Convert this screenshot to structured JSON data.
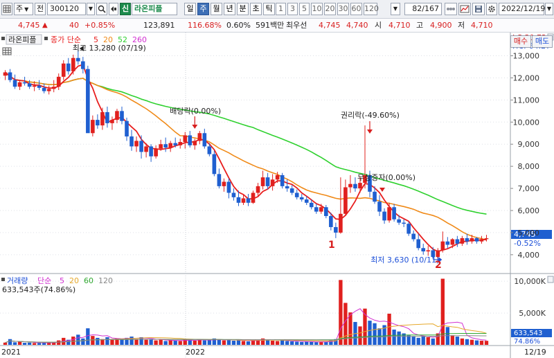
{
  "toolbar": {
    "grid_icon": "grid-icon",
    "type_label": "주",
    "sub_label": "전",
    "code": "300120",
    "search_icon": "search-icon",
    "zoom_icon": "zoom-icon",
    "credit_badge": "신",
    "stock_name": "라온피플",
    "period_tabs": [
      "일",
      "주",
      "월",
      "년",
      "분",
      "초",
      "틱"
    ],
    "active_period": "주",
    "intervals": [
      "1",
      "3",
      "5",
      "10",
      "20",
      "30",
      "60",
      "120"
    ],
    "page_counter": "82/167",
    "date": "2022/12/19"
  },
  "quote": {
    "price": "4,745",
    "change_arrow": "▲",
    "change": "40",
    "change_pct": "+0.85%",
    "volume": "123,891",
    "vol_ratio": "116.68%",
    "turnover": "0.60%",
    "bid_amount": "591백만",
    "bid_label": "최우선",
    "ask_price": "4,745",
    "bid_price": "4,740",
    "open_label": "시",
    "open": "4,710",
    "high_label": "고",
    "high": "4,900",
    "low_label": "저",
    "low": "4,710",
    "buy_label": "매수",
    "sell_label": "매도"
  },
  "price_panel": {
    "stock_label": "라온피플",
    "indicator_label": "종가 단순",
    "ma_periods": [
      "5",
      "20",
      "52",
      "260"
    ],
    "ma_colors": [
      "#e81e1e",
      "#f08a18",
      "#2fd12f",
      "#d12fd1"
    ],
    "lc_label": "LC:30.72",
    "hc_label": "HC:-64.27",
    "current_price": "4,745",
    "current_pct": "-0.52%",
    "high_note": "최고 13,280 (07/19)",
    "low_note": "최저 3,630 (10/11)",
    "event_dividend": "배당락(0.00%)",
    "event_rights": "권리락(-49.60%)",
    "event_bonus": "무상증자(0.00%)",
    "marker_1": "1",
    "marker_2": "2"
  },
  "volume_panel": {
    "label": "거래량",
    "indicator_label": "단순",
    "ma_periods": [
      "5",
      "20",
      "60",
      "120"
    ],
    "value_label": "633,543주(74.86%)",
    "current_volume": "633,543",
    "current_pct": "74.86%"
  },
  "x_axis": [
    "2021",
    "2022",
    "12/19"
  ],
  "colors": {
    "up": "#e0201e",
    "down": "#1f5fd0",
    "accent": "#3d6fb6"
  },
  "chart_data": {
    "type": "candlestick",
    "title": "라온피플 주",
    "y_axis": {
      "ticks": [
        4000,
        5000,
        6000,
        7000,
        8000,
        9000,
        10000,
        11000,
        12000,
        13000
      ],
      "tick_labels": [
        "4,000",
        "5,000",
        "6,000",
        "7,000",
        "8,000",
        "9,000",
        "10,000",
        "11,000",
        "12,000",
        "13,000"
      ],
      "ylim": [
        3400,
        13800
      ]
    },
    "volume_axis": {
      "ticks": [
        5000000,
        10000000
      ],
      "tick_labels": [
        "5,000K",
        "10,000K"
      ],
      "ylim": [
        0,
        11000000
      ]
    },
    "candles": [
      {
        "o": 12100,
        "h": 12350,
        "l": 11900,
        "c": 12250
      },
      {
        "o": 12250,
        "h": 12400,
        "l": 11800,
        "c": 11900
      },
      {
        "o": 11900,
        "h": 12150,
        "l": 11500,
        "c": 11600
      },
      {
        "o": 11600,
        "h": 11900,
        "l": 11450,
        "c": 11800
      },
      {
        "o": 11800,
        "h": 12050,
        "l": 11650,
        "c": 11750
      },
      {
        "o": 11750,
        "h": 11900,
        "l": 11500,
        "c": 11600
      },
      {
        "o": 11600,
        "h": 11850,
        "l": 11400,
        "c": 11650
      },
      {
        "o": 11650,
        "h": 11900,
        "l": 11450,
        "c": 11550
      },
      {
        "o": 11550,
        "h": 11750,
        "l": 11300,
        "c": 11400
      },
      {
        "o": 11400,
        "h": 11650,
        "l": 11250,
        "c": 11500
      },
      {
        "o": 11500,
        "h": 11900,
        "l": 11350,
        "c": 11600
      },
      {
        "o": 11600,
        "h": 12200,
        "l": 11450,
        "c": 12050
      },
      {
        "o": 12050,
        "h": 12800,
        "l": 11900,
        "c": 12650
      },
      {
        "o": 12650,
        "h": 12900,
        "l": 12150,
        "c": 12300
      },
      {
        "o": 12300,
        "h": 13050,
        "l": 12150,
        "c": 12900
      },
      {
        "o": 12900,
        "h": 13280,
        "l": 12600,
        "c": 12750
      },
      {
        "o": 12750,
        "h": 12950,
        "l": 12200,
        "c": 12400
      },
      {
        "o": 12400,
        "h": 12550,
        "l": 9600,
        "c": 9500
      },
      {
        "o": 9500,
        "h": 10300,
        "l": 9350,
        "c": 10100
      },
      {
        "o": 10100,
        "h": 10350,
        "l": 9700,
        "c": 9850
      },
      {
        "o": 9850,
        "h": 10650,
        "l": 9650,
        "c": 10450
      },
      {
        "o": 10450,
        "h": 10700,
        "l": 9750,
        "c": 9950
      },
      {
        "o": 9950,
        "h": 10250,
        "l": 9650,
        "c": 10100
      },
      {
        "o": 10100,
        "h": 10600,
        "l": 9950,
        "c": 10500
      },
      {
        "o": 10500,
        "h": 10700,
        "l": 9900,
        "c": 10050
      },
      {
        "o": 10050,
        "h": 10200,
        "l": 9150,
        "c": 9350
      },
      {
        "o": 9350,
        "h": 9650,
        "l": 8700,
        "c": 8900
      },
      {
        "o": 8900,
        "h": 9350,
        "l": 8650,
        "c": 9150
      },
      {
        "o": 9150,
        "h": 9400,
        "l": 8350,
        "c": 8650
      },
      {
        "o": 8650,
        "h": 9050,
        "l": 8400,
        "c": 8900
      },
      {
        "o": 8900,
        "h": 9000,
        "l": 8200,
        "c": 8450
      },
      {
        "o": 8450,
        "h": 8950,
        "l": 8350,
        "c": 8800
      },
      {
        "o": 8800,
        "h": 9200,
        "l": 8700,
        "c": 9000
      },
      {
        "o": 9000,
        "h": 9300,
        "l": 8650,
        "c": 8850
      },
      {
        "o": 8850,
        "h": 9150,
        "l": 8650,
        "c": 9050
      },
      {
        "o": 9050,
        "h": 9300,
        "l": 8850,
        "c": 8950
      },
      {
        "o": 8950,
        "h": 9250,
        "l": 8800,
        "c": 9100
      },
      {
        "o": 9100,
        "h": 9550,
        "l": 8800,
        "c": 9400
      },
      {
        "o": 9400,
        "h": 9600,
        "l": 8850,
        "c": 8950
      },
      {
        "o": 8950,
        "h": 9250,
        "l": 8750,
        "c": 9150
      },
      {
        "o": 9150,
        "h": 9600,
        "l": 9000,
        "c": 9500
      },
      {
        "o": 9500,
        "h": 9700,
        "l": 8800,
        "c": 8900
      },
      {
        "o": 8900,
        "h": 9050,
        "l": 8450,
        "c": 8550
      },
      {
        "o": 8550,
        "h": 8700,
        "l": 7550,
        "c": 7650
      },
      {
        "o": 7650,
        "h": 7900,
        "l": 7000,
        "c": 7100
      },
      {
        "o": 7100,
        "h": 7450,
        "l": 6850,
        "c": 7300
      },
      {
        "o": 7300,
        "h": 7450,
        "l": 6550,
        "c": 6800
      },
      {
        "o": 6800,
        "h": 7000,
        "l": 6450,
        "c": 6600
      },
      {
        "o": 6600,
        "h": 6900,
        "l": 6200,
        "c": 6350
      },
      {
        "o": 6350,
        "h": 6700,
        "l": 6250,
        "c": 6550
      },
      {
        "o": 6550,
        "h": 6750,
        "l": 6200,
        "c": 6350
      },
      {
        "o": 6350,
        "h": 6900,
        "l": 6300,
        "c": 6800
      },
      {
        "o": 6800,
        "h": 7250,
        "l": 6650,
        "c": 7100
      },
      {
        "o": 7100,
        "h": 7800,
        "l": 6950,
        "c": 7500
      },
      {
        "o": 7500,
        "h": 7700,
        "l": 6950,
        "c": 7100
      },
      {
        "o": 7100,
        "h": 7650,
        "l": 6900,
        "c": 7400
      },
      {
        "o": 7400,
        "h": 7750,
        "l": 7250,
        "c": 7600
      },
      {
        "o": 7600,
        "h": 7700,
        "l": 7000,
        "c": 7100
      },
      {
        "o": 7100,
        "h": 7400,
        "l": 6850,
        "c": 7000
      },
      {
        "o": 7000,
        "h": 7150,
        "l": 6700,
        "c": 6800
      },
      {
        "o": 6800,
        "h": 6950,
        "l": 6500,
        "c": 6600
      },
      {
        "o": 6600,
        "h": 6750,
        "l": 6400,
        "c": 6500
      },
      {
        "o": 6500,
        "h": 6650,
        "l": 6250,
        "c": 6350
      },
      {
        "o": 6350,
        "h": 6500,
        "l": 6050,
        "c": 6150
      },
      {
        "o": 6150,
        "h": 6300,
        "l": 5850,
        "c": 5950
      },
      {
        "o": 5950,
        "h": 6300,
        "l": 5850,
        "c": 6150
      },
      {
        "o": 6150,
        "h": 6250,
        "l": 5650,
        "c": 5750
      },
      {
        "o": 5750,
        "h": 5900,
        "l": 5100,
        "c": 5250
      },
      {
        "o": 5250,
        "h": 5450,
        "l": 4750,
        "c": 5000
      },
      {
        "o": 5000,
        "h": 7500,
        "l": 4950,
        "c": 5850
      },
      {
        "o": 5850,
        "h": 7400,
        "l": 5750,
        "c": 7050
      },
      {
        "o": 7050,
        "h": 7600,
        "l": 6800,
        "c": 7200
      },
      {
        "o": 7200,
        "h": 7500,
        "l": 6850,
        "c": 7000
      },
      {
        "o": 7000,
        "h": 7550,
        "l": 6800,
        "c": 7250
      },
      {
        "o": 7250,
        "h": 9850,
        "l": 7000,
        "c": 7600
      },
      {
        "o": 7600,
        "h": 7800,
        "l": 6600,
        "c": 6850
      },
      {
        "o": 6850,
        "h": 7100,
        "l": 6300,
        "c": 6400
      },
      {
        "o": 6400,
        "h": 6700,
        "l": 5750,
        "c": 5950
      },
      {
        "o": 5950,
        "h": 6100,
        "l": 5400,
        "c": 5550
      },
      {
        "o": 5550,
        "h": 6350,
        "l": 5450,
        "c": 6150
      },
      {
        "o": 6150,
        "h": 6300,
        "l": 5500,
        "c": 5600
      },
      {
        "o": 5600,
        "h": 5800,
        "l": 5350,
        "c": 5450
      },
      {
        "o": 5450,
        "h": 5600,
        "l": 5250,
        "c": 5400
      },
      {
        "o": 5400,
        "h": 5500,
        "l": 4850,
        "c": 4950
      },
      {
        "o": 4950,
        "h": 5100,
        "l": 4600,
        "c": 4700
      },
      {
        "o": 4700,
        "h": 4950,
        "l": 4200,
        "c": 4300
      },
      {
        "o": 4300,
        "h": 4500,
        "l": 4000,
        "c": 4150
      },
      {
        "o": 4150,
        "h": 4400,
        "l": 3950,
        "c": 4200
      },
      {
        "o": 4200,
        "h": 4350,
        "l": 3800,
        "c": 3900
      },
      {
        "o": 3900,
        "h": 4300,
        "l": 3630,
        "c": 4200
      },
      {
        "o": 4200,
        "h": 5050,
        "l": 4100,
        "c": 4600
      },
      {
        "o": 4600,
        "h": 4800,
        "l": 4300,
        "c": 4450
      },
      {
        "o": 4450,
        "h": 4750,
        "l": 4300,
        "c": 4700
      },
      {
        "o": 4700,
        "h": 4850,
        "l": 4350,
        "c": 4500
      },
      {
        "o": 4500,
        "h": 4850,
        "l": 4400,
        "c": 4750
      },
      {
        "o": 4750,
        "h": 4950,
        "l": 4450,
        "c": 4600
      },
      {
        "o": 4600,
        "h": 4900,
        "l": 4500,
        "c": 4750
      },
      {
        "o": 4750,
        "h": 4800,
        "l": 4500,
        "c": 4600
      },
      {
        "o": 4600,
        "h": 4850,
        "l": 4500,
        "c": 4705
      },
      {
        "o": 4705,
        "h": 4900,
        "l": 4600,
        "c": 4745
      }
    ],
    "volumes": [
      350000,
      900000,
      400000,
      500000,
      320000,
      350000,
      280000,
      300000,
      360000,
      320000,
      420000,
      700000,
      1100000,
      800000,
      1300000,
      1600000,
      1000000,
      2600000,
      1400000,
      1100000,
      900000,
      1200000,
      800000,
      1000000,
      900000,
      1100000,
      1300000,
      900000,
      1200000,
      800000,
      900000,
      700000,
      800000,
      600000,
      700000,
      650000,
      600000,
      900000,
      800000,
      650000,
      850000,
      700000,
      750000,
      1000000,
      800000,
      700000,
      750000,
      650000,
      800000,
      600000,
      550000,
      700000,
      800000,
      1000000,
      800000,
      650000,
      600000,
      700000,
      600000,
      550000,
      500000,
      450000,
      500000,
      480000,
      420000,
      500000,
      450000,
      700000,
      900000,
      10200000,
      6600000,
      5100000,
      3600000,
      2900000,
      5700000,
      3800000,
      3400000,
      2600000,
      3100000,
      4900000,
      2400000,
      2100000,
      1800000,
      1500000,
      1300000,
      1100000,
      1400000,
      1200000,
      1000000,
      1800000,
      10400000,
      2800000,
      1500000,
      1300000,
      1000000,
      900000,
      800000,
      700000,
      650000,
      633543
    ]
  }
}
